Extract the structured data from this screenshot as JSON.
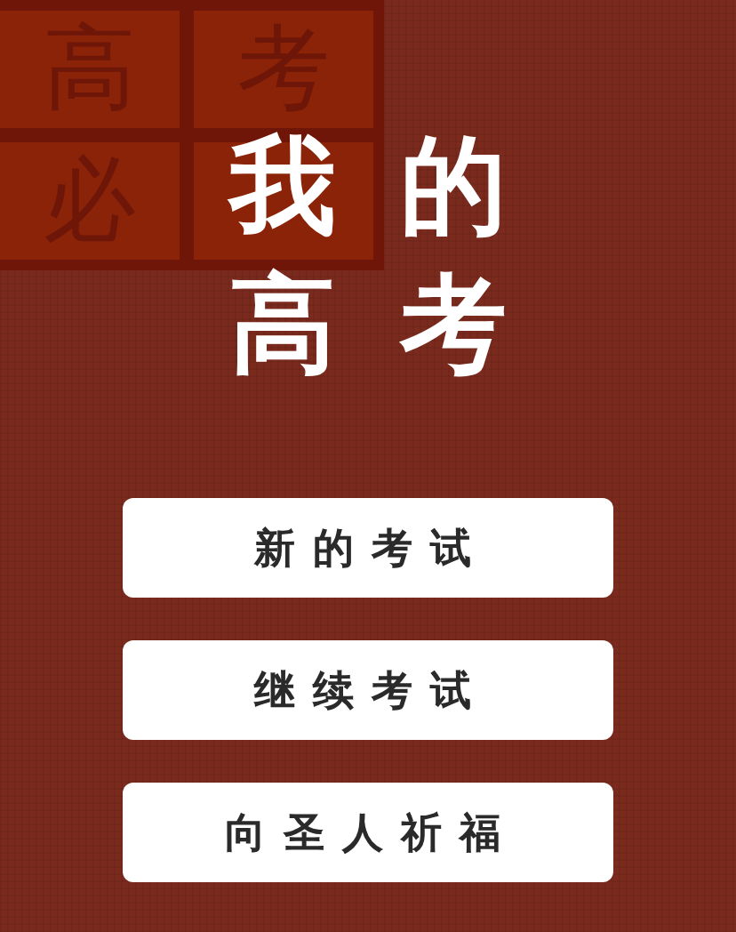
{
  "seal": {
    "chars": [
      "高",
      "考",
      "必"
    ]
  },
  "title": {
    "lines": [
      "我的",
      "高考"
    ]
  },
  "menu": [
    {
      "label": "新的考试"
    },
    {
      "label": "继续考试"
    },
    {
      "label": "向圣人祈福"
    }
  ]
}
